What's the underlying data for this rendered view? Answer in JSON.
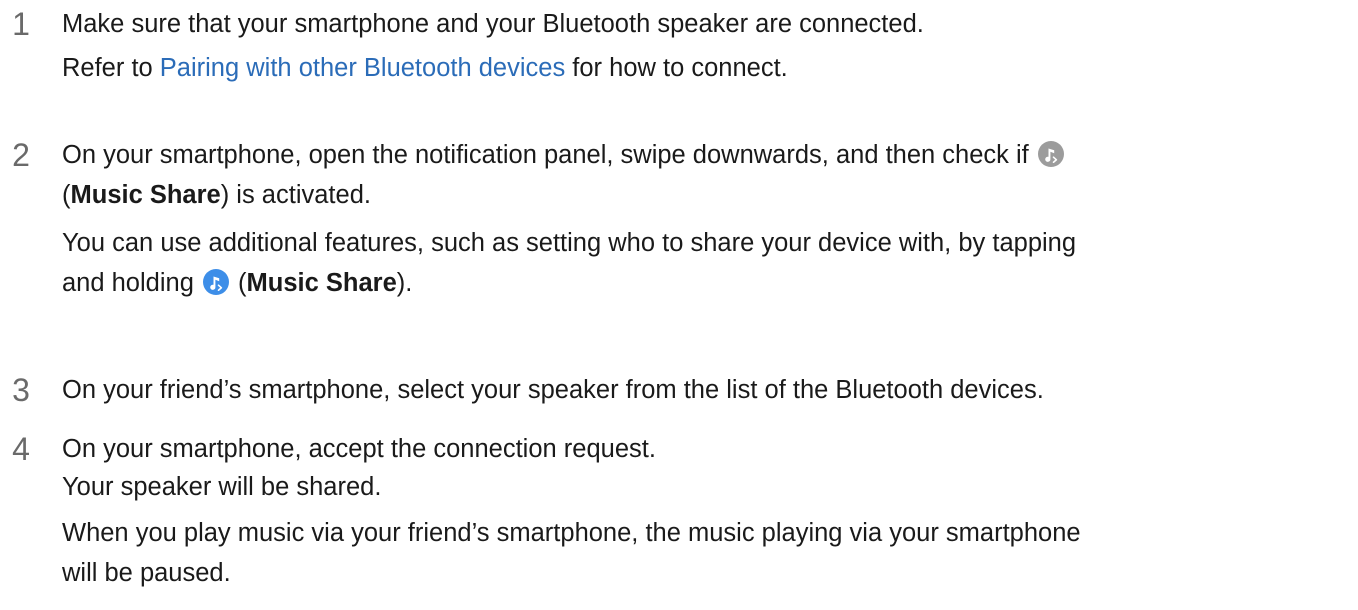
{
  "steps": [
    {
      "number": "1",
      "main_text": "Make sure that your smartphone and your Bluetooth speaker are connected.",
      "sub_prefix": "Refer to ",
      "sub_link": "Pairing with other Bluetooth devices",
      "sub_suffix": " for how to connect."
    },
    {
      "number": "2",
      "line1_text": "On your smartphone, open the notification panel, swipe downwards, and then check if",
      "line2_open": "(",
      "line2_bold": "Music Share",
      "line2_rest": ") is activated.",
      "line3_text": "You can use additional features, such as setting who to share your device with, by tapping",
      "line4_prefix": "and holding ",
      "line4_open": " (",
      "line4_bold": "Music Share",
      "line4_rest": ").",
      "icon_gray": "music-share-icon",
      "icon_blue": "music-share-icon"
    },
    {
      "number": "3",
      "main_text": "On your friend’s smartphone, select your speaker from the list of the Bluetooth devices."
    },
    {
      "number": "4",
      "main_text": "On your smartphone, accept the connection request.",
      "line2_text": "Your speaker will be shared.",
      "line3_text": "When you play music via your friend’s smartphone, the music playing via your smartphone",
      "line4_text": "will be paused."
    }
  ],
  "colors": {
    "link": "#2b6cb8",
    "step_number": "#6a6a6a",
    "icon_inactive": "#9c9c9c",
    "icon_active": "#3d8ee8"
  }
}
